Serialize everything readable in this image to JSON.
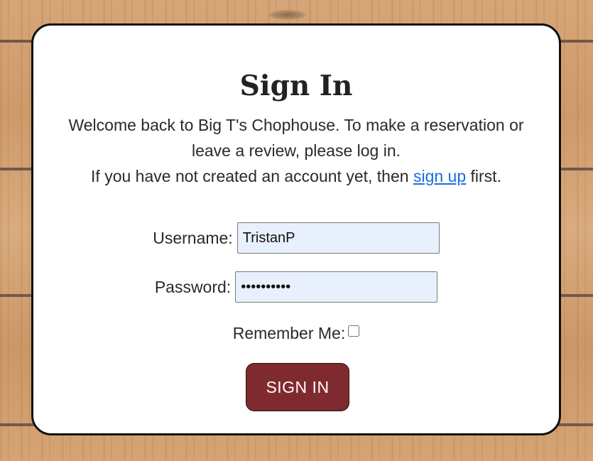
{
  "page": {
    "background": "wood-planks"
  },
  "header": {
    "title": "Sign In"
  },
  "intro": {
    "line1": "Welcome back to Big T's Chophouse. To make a reservation or leave a review, please log in.",
    "line2_prefix": "If you have not created an account yet, then ",
    "signup_link": "sign up",
    "line2_suffix": " first."
  },
  "form": {
    "username_label": "Username:",
    "username_value": "TristanP",
    "password_label": "Password:",
    "password_value": "••••••••••",
    "remember_label": "Remember Me:",
    "remember_checked": false,
    "submit_label": "SIGN IN"
  },
  "colors": {
    "primary_button": "#7f2a2f",
    "link": "#1a6fd8",
    "input_autofill": "#e8f0fe"
  }
}
